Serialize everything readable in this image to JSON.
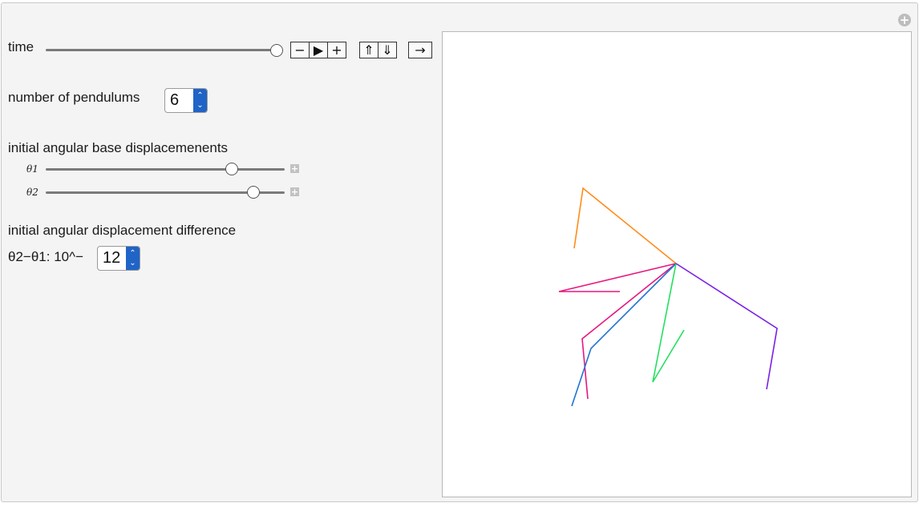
{
  "controls": {
    "time_label": "time",
    "time_value": 1.0,
    "animator_buttons": [
      "−",
      "▶",
      "+",
      "⇑",
      "⇓",
      "→"
    ],
    "pendulums_label": "number of pendulums",
    "pendulums_value": "6",
    "base_displacement_label": "initial angular base displacemenents",
    "theta1_label": "θ1",
    "theta1_value": 0.78,
    "theta2_label": "θ2",
    "theta2_value": 0.87,
    "difference_label": "initial angular displacement difference",
    "difference_expr": "θ2−θ1: 10^−",
    "difference_value": "12"
  },
  "chart_data": {
    "type": "line",
    "title": "",
    "pivot": [
      843,
      329
    ],
    "series": [
      {
        "color": "#ff8c1a",
        "points": [
          [
            843,
            329
          ],
          [
            727,
            235
          ],
          [
            716,
            310
          ]
        ]
      },
      {
        "color": "#e8177f",
        "points": [
          [
            843,
            329
          ],
          [
            697,
            364
          ],
          [
            773,
            364
          ]
        ]
      },
      {
        "color": "#e8177f",
        "points": [
          [
            843,
            329
          ],
          [
            726,
            423
          ],
          [
            733,
            498
          ]
        ]
      },
      {
        "color": "#1e73d2",
        "points": [
          [
            843,
            329
          ],
          [
            737,
            435
          ],
          [
            713,
            507
          ]
        ]
      },
      {
        "color": "#22e060",
        "points": [
          [
            843,
            329
          ],
          [
            814,
            477
          ],
          [
            853,
            412
          ]
        ]
      },
      {
        "color": "#7a1fe8",
        "points": [
          [
            843,
            329
          ],
          [
            969,
            410
          ],
          [
            956,
            486
          ]
        ]
      }
    ]
  }
}
